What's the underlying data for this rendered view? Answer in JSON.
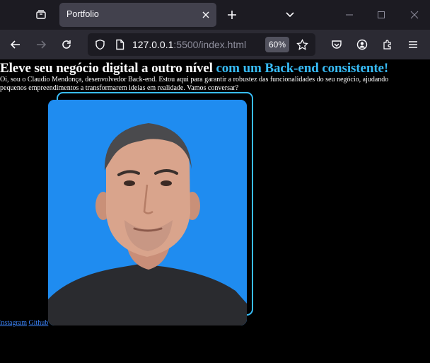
{
  "browser": {
    "tab_title": "Portfolio",
    "url_host": "127.0.0.1",
    "url_rest": ":5500/index.html",
    "zoom": "60%"
  },
  "hero": {
    "title": "Eleve seu negócio digital a outro nível",
    "title_accent": "com um Back-end consistente!",
    "text": "Oi, sou o Claudio Mendonça, desenvolvedor Back-end. Estou aqui para garantir a robustez das funcionalidades do seu negócio, ajudando pequenos empreendimentos a transformarem ideias em realidade. Vamos conversar?",
    "accent_color": "#38bdf8",
    "photo_bg_color": "#1f8cf0"
  },
  "social": {
    "instagram": "Instagram",
    "github": "Github"
  }
}
